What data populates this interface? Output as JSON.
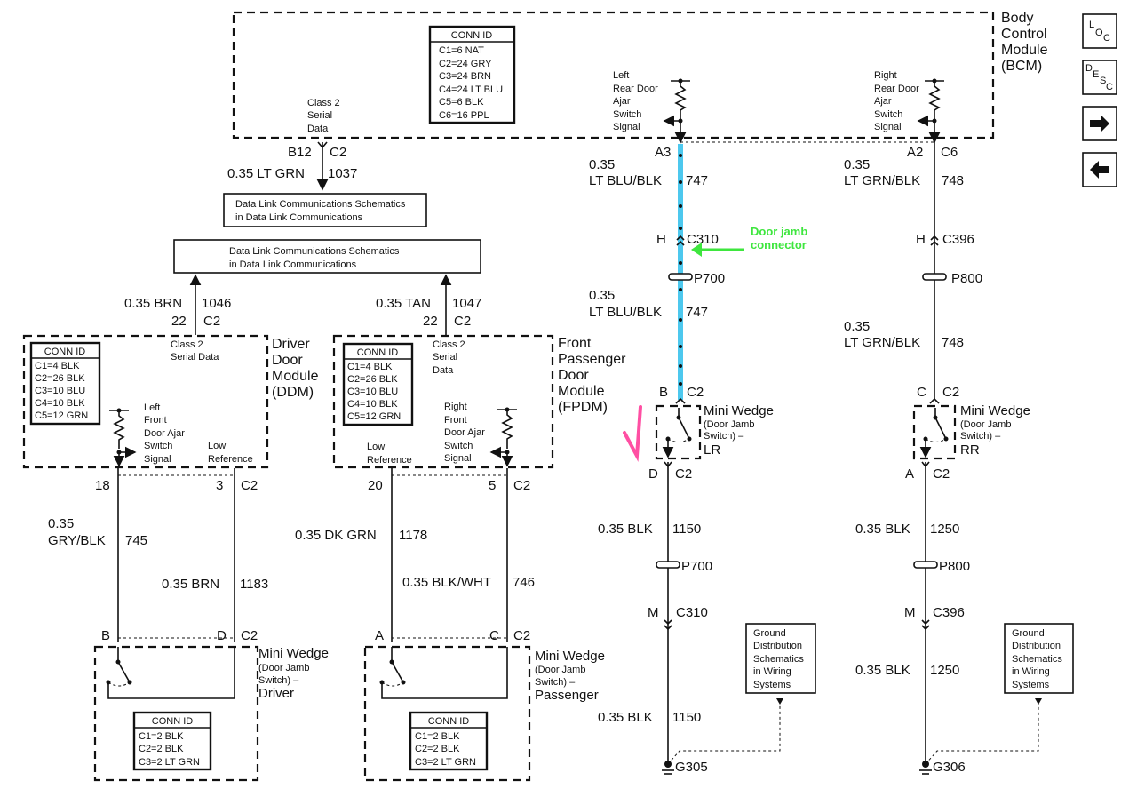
{
  "colors": {
    "highlight_wire": "#4dc8ee",
    "annotation_green": "#3ee63e",
    "annotation_pink": "#ff4fa3"
  },
  "bcm": {
    "title": [
      "Body",
      "Control",
      "Module",
      "(BCM)"
    ],
    "conn_id": {
      "header": "CONN ID",
      "rows": [
        "C1=6 NAT",
        "C2=24 GRY",
        "C3=24 BRN",
        "C4=24 LT BLU",
        "C5=6 BLK",
        "C6=16 PPL"
      ]
    },
    "class2": [
      "Class 2",
      "Serial",
      "Data"
    ],
    "left_signal": [
      "Left",
      "Rear Door",
      "Ajar",
      "Switch",
      "Signal"
    ],
    "right_signal": [
      "Right",
      "Rear Door",
      "Ajar",
      "Switch",
      "Signal"
    ]
  },
  "nav": {
    "loc": [
      "L",
      "O",
      "C"
    ],
    "desc": [
      "D",
      "E",
      "S",
      "C"
    ],
    "icons": [
      "arrow-right-icon",
      "arrow-left-icon"
    ]
  },
  "serial_wire": {
    "pin": "B12",
    "conn": "C2",
    "gauge": "0.35 LT GRN",
    "circuit": "1037"
  },
  "dl_box_1": [
    "Data Link Communications Schematics",
    "in Data Link Communications"
  ],
  "dl_box_2": [
    "Data Link Communications Schematics",
    "in Data Link Communications"
  ],
  "ddm_serial": {
    "gauge": "0.35 BRN",
    "circuit": "1046",
    "pin": "22",
    "conn": "C2"
  },
  "fpdm_serial": {
    "gauge": "0.35 TAN",
    "circuit": "1047",
    "pin": "22",
    "conn": "C2"
  },
  "ddm": {
    "title": [
      "Driver",
      "Door",
      "Module",
      "(DDM)"
    ],
    "conn_id": {
      "header": "CONN ID",
      "rows": [
        "C1=4 BLK",
        "C2=26 BLK",
        "C3=10 BLU",
        "C4=10 BLK",
        "C5=12 GRN"
      ]
    },
    "class2": [
      "Class 2",
      "Serial Data"
    ],
    "signal": [
      "Left",
      "Front",
      "Door Ajar",
      "Switch",
      "Signal"
    ],
    "low_ref": [
      "Low",
      "Reference"
    ]
  },
  "fpdm": {
    "title": [
      "Front",
      "Passenger",
      "Door",
      "Module",
      "(FPDM)"
    ],
    "conn_id": {
      "header": "CONN ID",
      "rows": [
        "C1=4 BLK",
        "C2=26 BLK",
        "C3=10 BLU",
        "C4=10 BLK",
        "C5=12 GRN"
      ]
    },
    "class2": [
      "Class 2",
      "Serial",
      "Data"
    ],
    "signal": [
      "Right",
      "Front",
      "Door Ajar",
      "Switch",
      "Signal"
    ],
    "low_ref": [
      "Low",
      "Reference"
    ]
  },
  "ddm_wires": {
    "pin_a": "18",
    "pin_b": "3",
    "conn": "C2",
    "w1_gauge": [
      "0.35",
      "GRY/BLK"
    ],
    "w1_circuit": "745",
    "w2_gauge": "0.35 BRN",
    "w2_circuit": "1183",
    "sw_pin_a": "B",
    "sw_pin_b": "D",
    "sw_conn": "C2"
  },
  "fpdm_wires": {
    "pin_a": "20",
    "pin_b": "5",
    "conn": "C2",
    "w1_gauge": "0.35 DK GRN",
    "w1_circuit": "1178",
    "w2_gauge": "0.35 BLK/WHT",
    "w2_circuit": "746",
    "sw_pin_a": "A",
    "sw_pin_b": "C",
    "sw_conn": "C2"
  },
  "driver_switch": {
    "title": [
      "Mini Wedge",
      "(Door Jamb",
      "Switch) –",
      "Driver"
    ],
    "conn_id": {
      "header": "CONN ID",
      "rows": [
        "C1=2 BLK",
        "C2=2 BLK",
        "C3=2 LT GRN"
      ]
    }
  },
  "pass_switch": {
    "title": [
      "Mini Wedge",
      "(Door Jamb",
      "Switch) –",
      "Passenger"
    ],
    "conn_id": {
      "header": "CONN ID",
      "rows": [
        "C1=2 BLK",
        "C2=2 BLK",
        "C3=2 LT GRN"
      ]
    }
  },
  "lr": {
    "bcm_pin": "A3",
    "gauge1": [
      "0.35",
      "LT BLU/BLK"
    ],
    "circuit1": "747",
    "inline_pin": "H",
    "inline_conn": "C310",
    "splice": "P700",
    "gauge2": [
      "0.35",
      "LT BLU/BLK"
    ],
    "circuit2": "747",
    "sw_top_pin": "B",
    "sw_top_conn": "C2",
    "switch_title": [
      "Mini Wedge",
      "(Door Jamb",
      "Switch) –",
      "LR"
    ],
    "sw_bot_pin": "D",
    "sw_bot_conn": "C2",
    "gauge3": "0.35 BLK",
    "circuit3": "1150",
    "splice2": "P700",
    "inline2_pin": "M",
    "inline2_conn": "C310",
    "gauge4": "0.35 BLK",
    "circuit4": "1150",
    "ground": "G305",
    "ground_ref": [
      "Ground",
      "Distribution",
      "Schematics",
      "in Wiring",
      "Systems"
    ]
  },
  "rr": {
    "bcm_pin": "A2",
    "bcm_conn": "C6",
    "gauge1": [
      "0.35",
      "LT GRN/BLK"
    ],
    "circuit1": "748",
    "inline_pin": "H",
    "inline_conn": "C396",
    "splice": "P800",
    "gauge2": [
      "0.35",
      "LT GRN/BLK"
    ],
    "circuit2": "748",
    "sw_top_pin": "C",
    "sw_top_conn": "C2",
    "switch_title": [
      "Mini Wedge",
      "(Door Jamb",
      "Switch) –",
      "RR"
    ],
    "sw_bot_pin": "A",
    "sw_bot_conn": "C2",
    "gauge3": "0.35 BLK",
    "circuit3": "1250",
    "splice2": "P800",
    "inline2_pin": "M",
    "inline2_conn": "C396",
    "gauge4": "0.35 BLK",
    "circuit4": "1250",
    "ground": "G306",
    "ground_ref": [
      "Ground",
      "Distribution",
      "Schematics",
      "in Wiring",
      "Systems"
    ]
  },
  "annotation": {
    "text": [
      "Door jamb",
      "connector"
    ]
  }
}
